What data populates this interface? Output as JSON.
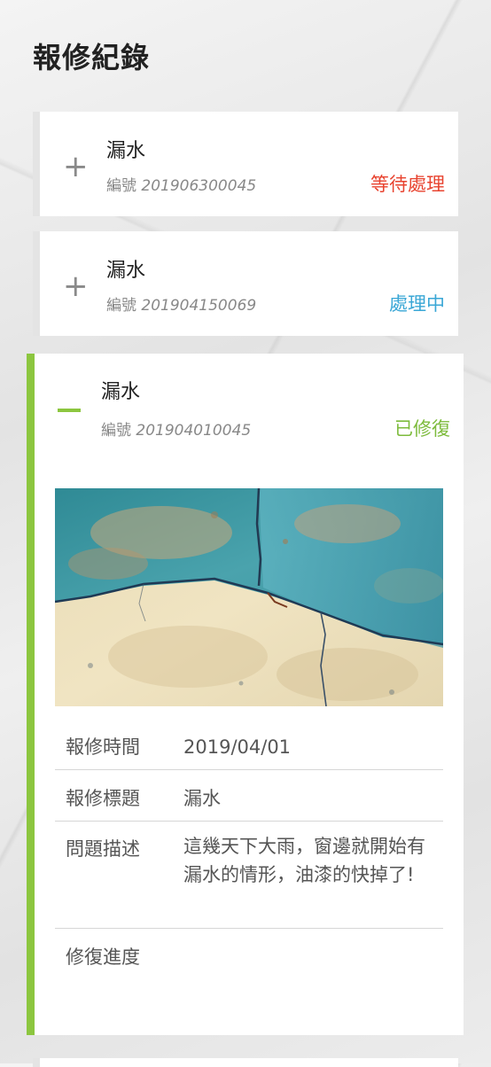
{
  "page": {
    "title": "報修紀錄"
  },
  "records": [
    {
      "title": "漏水",
      "number_label": "編號",
      "number": "201906300045",
      "status": "等待處理",
      "status_color": "#e8432f",
      "expanded": false,
      "toggle_icon": "plus-icon"
    },
    {
      "title": "漏水",
      "number_label": "編號",
      "number": "201904150069",
      "status": "處理中",
      "status_color": "#3aa7d6",
      "expanded": false,
      "toggle_icon": "plus-icon"
    },
    {
      "title": "漏水",
      "number_label": "編號",
      "number": "201904010045",
      "status": "已修復",
      "status_color": "#7dbb3c",
      "expanded": true,
      "toggle_icon": "minus-icon",
      "accent_color": "#8cc63f",
      "photo": "cracked-wall-photo",
      "details": [
        {
          "label": "報修時間",
          "value": "2019/04/01"
        },
        {
          "label": "報修標題",
          "value": "漏水"
        },
        {
          "label": "問題描述",
          "value": "這幾天下大雨，窗邊就開始有漏水的情形，油漆的快掉了!"
        },
        {
          "label": "修復進度",
          "value": ""
        }
      ]
    }
  ]
}
